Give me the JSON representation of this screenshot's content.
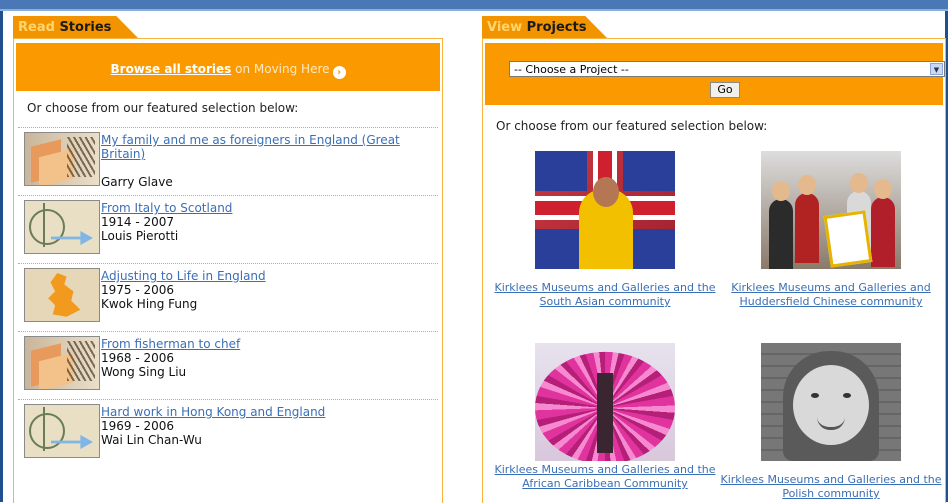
{
  "stories_tab": {
    "word1": "Read",
    "word2": "Stories"
  },
  "projects_tab": {
    "word1": "View",
    "word2": "Projects"
  },
  "browse": {
    "link_label": "Browse all stories",
    "suffix": " on Moving Here"
  },
  "featured_text": "Or choose from our featured selection below:",
  "stories": [
    {
      "title": "My family and me as foreigners in England (Great Britain)",
      "years": "",
      "author": "Garry Glave",
      "thumb_icon": "photo-thumbnail-icon"
    },
    {
      "title": "From Italy to Scotland",
      "years": "1914 - 2007",
      "author": "Louis Pierotti",
      "thumb_icon": "map-thumbnail-icon"
    },
    {
      "title": "Adjusting to Life in England",
      "years": "1975 - 2006",
      "author": "Kwok Hing Fung",
      "thumb_icon": "uk-map-thumbnail-icon"
    },
    {
      "title": "From fisherman to chef",
      "years": "1968 - 2006",
      "author": "Wong Sing Liu",
      "thumb_icon": "photo-thumbnail-icon"
    },
    {
      "title": "Hard work in Hong Kong and England",
      "years": "1969 - 2006",
      "author": "Wai Lin Chan-Wu",
      "thumb_icon": "map-thumbnail-icon"
    }
  ],
  "project_select": {
    "selected": "-- Choose a Project --",
    "go_label": "Go"
  },
  "projects": [
    {
      "label": "Kirklees Museums and Galleries and the South Asian community"
    },
    {
      "label": "Kirklees Museums and Galleries and Huddersfield Chinese community"
    },
    {
      "label": "Kirklees Museums and Galleries and the African Caribbean Community"
    },
    {
      "label": "Kirklees Museums and Galleries and the Polish community"
    }
  ],
  "colors": {
    "accent_orange": "#fb9a00",
    "link_blue": "#3a6fb7",
    "frame_blue": "#4a78b7"
  }
}
